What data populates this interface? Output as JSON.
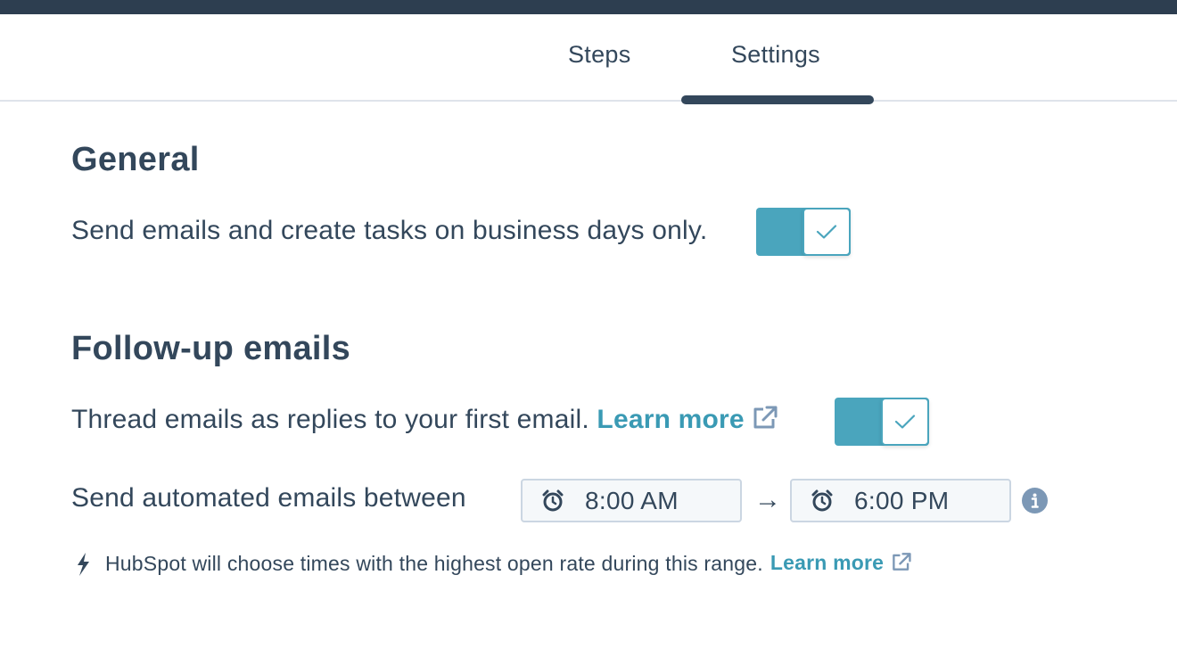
{
  "tabs": [
    {
      "label": "Steps",
      "selected": false
    },
    {
      "label": "Settings",
      "selected": true
    }
  ],
  "general": {
    "heading": "General",
    "business_days_label": "Send emails and create tasks on business days only.",
    "business_days_enabled": true
  },
  "followup": {
    "heading": "Follow-up emails",
    "thread_label": "Thread emails as replies to your first email.",
    "thread_learn_more": "Learn more",
    "thread_enabled": true,
    "send_between_label": "Send automated emails between",
    "start_time": "8:00 AM",
    "end_time": "6:00 PM",
    "arrow": "→",
    "hint_text": "HubSpot will choose times with the highest open rate during this range.",
    "hint_learn_more": "Learn more"
  },
  "icons": {
    "toggle_check": "check-icon",
    "external_link": "external-link-icon",
    "clock": "alarm-clock-icon",
    "info": "info-icon",
    "bolt": "lightning-bolt-icon"
  },
  "colors": {
    "topbar": "#2d3e50",
    "toggle_on": "#4aa5bd",
    "link": "#3a9ab4",
    "text": "#33475b",
    "info": "#7c98b6"
  }
}
